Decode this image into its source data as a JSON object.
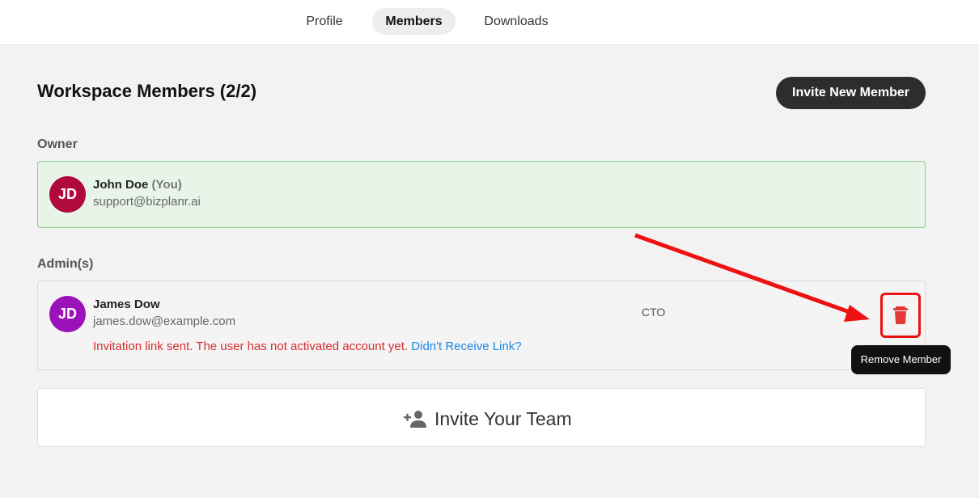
{
  "tabs": [
    {
      "label": "Profile",
      "active": false
    },
    {
      "label": "Members",
      "active": true
    },
    {
      "label": "Downloads",
      "active": false
    }
  ],
  "header": {
    "title": "Workspace Members (2/2)",
    "invite_button": "Invite New Member"
  },
  "owner_section": {
    "label": "Owner",
    "member": {
      "initials": "JD",
      "name": "John Doe",
      "suffix": "(You)",
      "email": "support@bizplanr.ai",
      "avatar_color": "#b0093e"
    }
  },
  "admin_section": {
    "label": "Admin(s)",
    "member": {
      "initials": "JD",
      "name": "James Dow",
      "email": "james.dow@example.com",
      "role": "CTO",
      "status_message": "Invitation link sent. The user has not activated account yet.",
      "resend_link": "Didn't Receive Link?",
      "avatar_color": "#9b12b8",
      "remove_icon": "trash-icon"
    }
  },
  "tooltip": {
    "text": "Remove Member"
  },
  "invite_team": {
    "label": "Invite Your Team",
    "icon": "person-add-icon"
  },
  "colors": {
    "annotation": "#ee1111",
    "status_error": "#d32f2f",
    "link": "#1e88e5"
  }
}
